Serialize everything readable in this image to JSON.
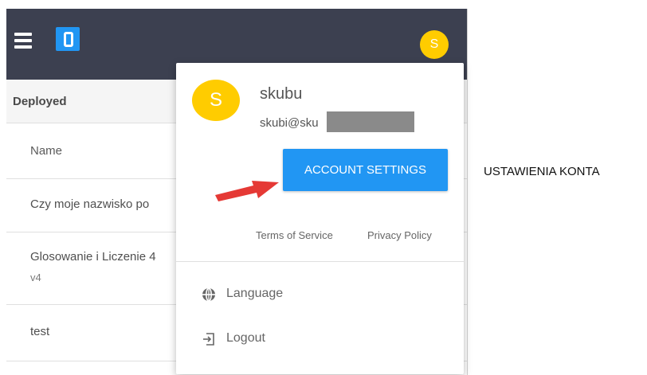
{
  "colors": {
    "topbar": "#3c4050",
    "brand": "#2196f3",
    "avatar": "#ffcc00",
    "arrow": "#e53935"
  },
  "header": {
    "logo_icon": "app-logo-icon",
    "menu_icon": "hamburger-menu-icon",
    "avatar_initial": "S"
  },
  "list": {
    "section_title": "Deployed",
    "column_header": "Name",
    "rows": [
      {
        "name": "Czy moje nazwisko po",
        "version": ""
      },
      {
        "name": "Glosowanie i Liczenie 4",
        "version": "v4"
      },
      {
        "name": "test",
        "version": ""
      }
    ]
  },
  "account_menu": {
    "avatar_initial": "S",
    "username": "skubu",
    "email_visible": "skubi@sku",
    "account_settings_label": "ACCOUNT SETTINGS",
    "terms_label": "Terms of Service",
    "privacy_label": "Privacy Policy",
    "items": [
      {
        "label": "Language",
        "icon": "globe-icon"
      },
      {
        "label": "Logout",
        "icon": "logout-icon"
      }
    ]
  },
  "annotation": {
    "side_note": "USTAWIENIA KONTA"
  }
}
